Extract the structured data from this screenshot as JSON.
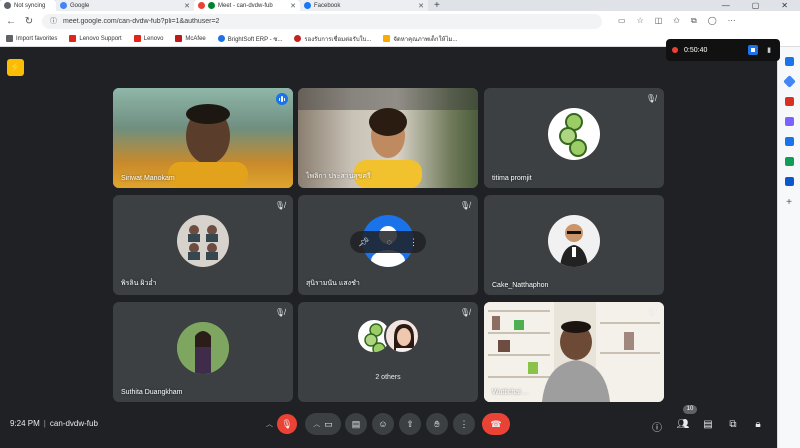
{
  "browser": {
    "tabs": [
      {
        "title": "Not syncing"
      },
      {
        "title": "Google"
      },
      {
        "title": "Meet - can-dvdw-fub"
      },
      {
        "title": "Facebook"
      }
    ],
    "new_tab": "+",
    "url": "meet.google.com/can-dvdw-fub?pli=1&authuser=2",
    "bookmarks": [
      {
        "label": "Import favorites",
        "color": "#5f6368"
      },
      {
        "label": "Lenovo Support",
        "color": "#e2231a"
      },
      {
        "label": "Lenovo",
        "color": "#e2231a"
      },
      {
        "label": "McAfee",
        "color": "#c01818"
      },
      {
        "label": "BrightSoft ERP - ซ...",
        "color": "#1a73e8"
      },
      {
        "label": "รองรับการเชื่อมต่อรับใบ...",
        "color": "#c5221f"
      },
      {
        "label": "จัดหาคุณภาพเด็กให้ไม...",
        "color": "#f9ab00"
      }
    ]
  },
  "recording": {
    "time": "0:50:40"
  },
  "participants": [
    {
      "name": "Siriwat Manokam",
      "muted": false,
      "speaking": true
    },
    {
      "name": "ไพลิกา ประสานสุขศรี",
      "muted": false
    },
    {
      "name": "titima promjit",
      "muted": true
    },
    {
      "name": "พิรลิน ผิวอ่ำ",
      "muted": true
    },
    {
      "name": "สุนิรามนัน แสงชำ",
      "muted": true
    },
    {
      "name": "Cake_Natthaphon",
      "muted": false
    },
    {
      "name": "Suthita Duangkham",
      "muted": true
    },
    {
      "name": "",
      "muted": true,
      "others_label": "2 others"
    },
    {
      "name": "Wuttichai ...",
      "muted": true
    }
  ],
  "meeting": {
    "time": "9:24 PM",
    "code": "can-dvdw-fub",
    "people_count": "10"
  },
  "colors": {
    "background": "#202124",
    "tile": "#3c4043",
    "accent": "#8ab4f8",
    "end_call": "#ea4335",
    "record": "#ea4335"
  }
}
